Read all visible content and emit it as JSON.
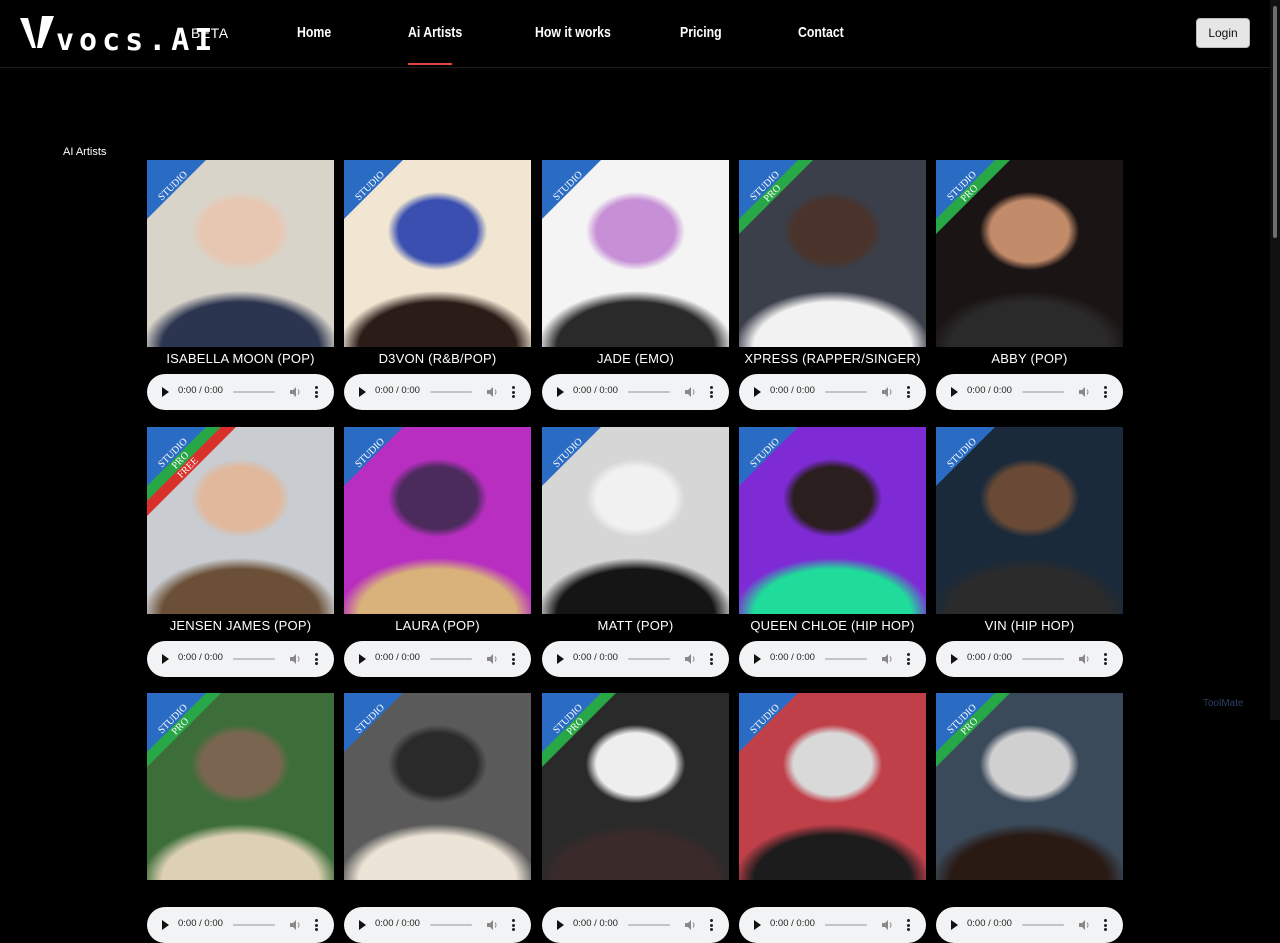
{
  "header": {
    "brand": "vocs.AI",
    "beta": "BETA",
    "nav": [
      "Home",
      "Ai Artists",
      "How it works",
      "Pricing",
      "Contact"
    ],
    "active_nav": "Ai Artists",
    "login_label": "Login"
  },
  "section_label": "AI Artists",
  "player_time": "0:00 / 0:00",
  "artists": [
    {
      "name": "ISABELLA MOON (POP)",
      "tiers": [
        "STUDIO"
      ],
      "colors": [
        "#2a6cc4"
      ]
    },
    {
      "name": "D3VON (R&B/POP)",
      "tiers": [
        "STUDIO"
      ],
      "colors": [
        "#2a6cc4"
      ]
    },
    {
      "name": "JADE (EMO)",
      "tiers": [
        "STUDIO"
      ],
      "colors": [
        "#2a6cc4"
      ]
    },
    {
      "name": "XPRESS (RAPPER/SINGER)",
      "tiers": [
        "STUDIO",
        "PRO"
      ],
      "colors": [
        "#2a6cc4",
        "#27a745"
      ]
    },
    {
      "name": "ABBY (POP)",
      "tiers": [
        "STUDIO",
        "PRO"
      ],
      "colors": [
        "#2a6cc4",
        "#27a745"
      ]
    },
    {
      "name": "JENSEN JAMES (POP)",
      "tiers": [
        "STUDIO",
        "PRO",
        "FREE"
      ],
      "colors": [
        "#2a6cc4",
        "#27a745",
        "#d9302c"
      ]
    },
    {
      "name": "LAURA (POP)",
      "tiers": [
        "STUDIO"
      ],
      "colors": [
        "#2a6cc4"
      ]
    },
    {
      "name": "MATT (POP)",
      "tiers": [
        "STUDIO"
      ],
      "colors": [
        "#2a6cc4"
      ]
    },
    {
      "name": "QUEEN CHLOE (HIP HOP)",
      "tiers": [
        "STUDIO"
      ],
      "colors": [
        "#2a6cc4"
      ]
    },
    {
      "name": "VIN (HIP HOP)",
      "tiers": [
        "STUDIO"
      ],
      "colors": [
        "#2a6cc4"
      ]
    },
    {
      "name": "",
      "tiers": [
        "STUDIO",
        "PRO"
      ],
      "colors": [
        "#2a6cc4",
        "#27a745"
      ]
    },
    {
      "name": "",
      "tiers": [
        "STUDIO"
      ],
      "colors": [
        "#2a6cc4"
      ]
    },
    {
      "name": "",
      "tiers": [
        "STUDIO",
        "PRO"
      ],
      "colors": [
        "#2a6cc4",
        "#27a745"
      ]
    },
    {
      "name": "",
      "tiers": [
        "STUDIO"
      ],
      "colors": [
        "#2a6cc4"
      ]
    },
    {
      "name": "",
      "tiers": [
        "STUDIO",
        "PRO"
      ],
      "colors": [
        "#2a6cc4",
        "#27a745"
      ]
    }
  ],
  "photo_palettes": [
    [
      "#d9d4ca",
      "#2b3550",
      "#e7c7b2"
    ],
    [
      "#f0e6d2",
      "#2a1d18",
      "#3a4fb0"
    ],
    [
      "#f4f4f4",
      "#2a2a2a",
      "#c78fd6"
    ],
    [
      "#3a3f4a",
      "#f2f2f2",
      "#4a332b"
    ],
    [
      "#1b1414",
      "#2a2a2a",
      "#c28b6a"
    ],
    [
      "#c9ccd0",
      "#6b5037",
      "#e1b89c"
    ],
    [
      "#b82ec0",
      "#d8b27a",
      "#4a2b5c"
    ],
    [
      "#d6d6d6",
      "#151515",
      "#f1f1f1"
    ],
    [
      "#7e2bd6",
      "#1fdc9a",
      "#2a1e1e"
    ],
    [
      "#1a2a3a",
      "#2b2b2b",
      "#6a4a36"
    ],
    [
      "#3d6e3a",
      "#ddd0b4",
      "#7a6650"
    ],
    [
      "#5a5a5a",
      "#ece4d6",
      "#2a2a2a"
    ],
    [
      "#2a2a2a",
      "#3a2a2a",
      "#eeeeee"
    ],
    [
      "#c0404a",
      "#1c1c1c",
      "#d9d9d9"
    ],
    [
      "#3a4a5a",
      "#2a1a14",
      "#d0d0d0"
    ]
  ],
  "watermark": "ToolMate"
}
